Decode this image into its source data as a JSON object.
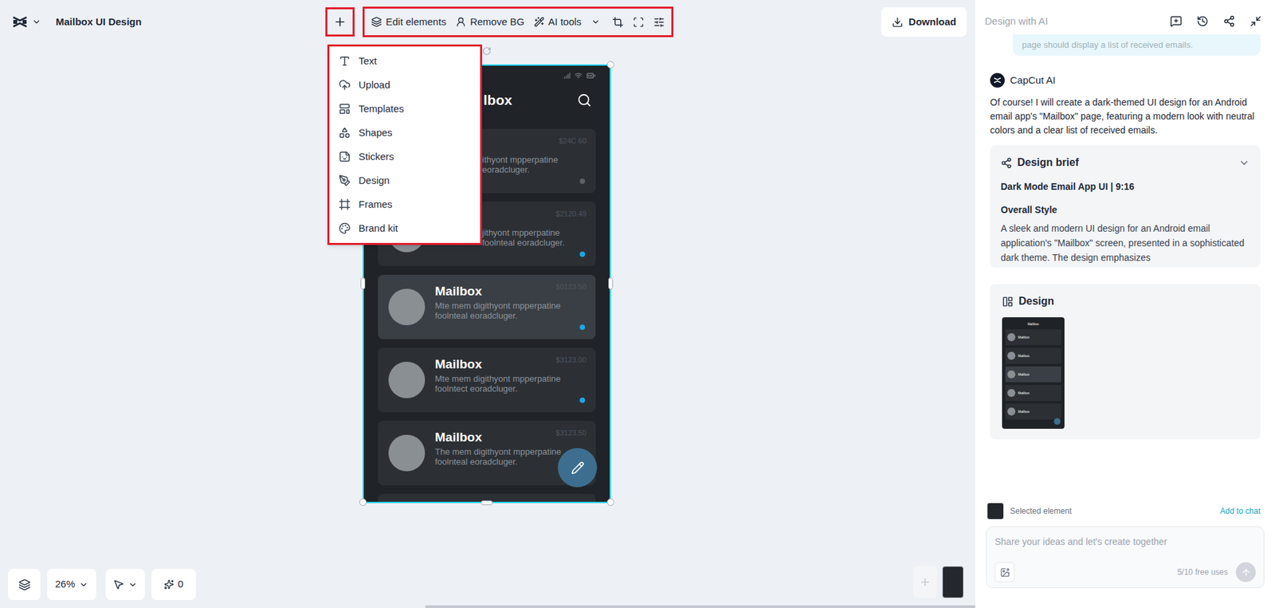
{
  "app": {
    "title": "Mailbox UI Design"
  },
  "toolbar": [
    {
      "label": "Edit elements"
    },
    {
      "label": "Remove BG"
    },
    {
      "label": "AI tools"
    }
  ],
  "download": "Download",
  "add_menu": [
    "Text",
    "Upload",
    "Templates",
    "Shapes",
    "Stickers",
    "Design",
    "Frames",
    "Brand kit"
  ],
  "phone": {
    "header": "lbox",
    "emails": [
      {
        "kind": "covered",
        "title": "",
        "time": "$24C 60",
        "lines": [
          "ithyont mpperpatine",
          "eoradcluger."
        ],
        "unread": false,
        "selected": false
      },
      {
        "kind": "covered",
        "title": "",
        "time": "$2120.49",
        "lines": [
          "jithyont mpperpatine",
          "foolnteal eoradcluger."
        ],
        "unread": true,
        "selected": false
      },
      {
        "kind": "full",
        "title": "Mailbox",
        "time": "$0123.50",
        "lines": [
          "Mte mem digithyont mpperpatine",
          "foolnteal eoradcluger."
        ],
        "unread": true,
        "selected": true
      },
      {
        "kind": "full",
        "title": "Mailbox",
        "time": "$3123.00",
        "lines": [
          "Mte mem digithyont mpperpatine",
          "foolntect eoradcluger."
        ],
        "unread": true,
        "selected": false
      },
      {
        "kind": "full",
        "title": "Mailbox",
        "time": "$3123.50",
        "lines": [
          "The mem digithyont mpperpatine",
          "foolnteal eoradcluger."
        ],
        "unread": false,
        "selected": false
      }
    ]
  },
  "zoom": "26%",
  "credits": "0",
  "panel": {
    "title": "Design with AI",
    "user_message": "page should display a list of received emails.",
    "assistant": "CapCut AI",
    "reply": "Of course! I will create a dark-themed UI design for an Android email app's \"Mailbox\" page, featuring a modern look with neutral colors and a clear list of received emails.",
    "brief": {
      "title": "Design brief",
      "expanded": false,
      "subtitle": "Dark Mode Email App UI | 9:16",
      "section": "Overall Style",
      "text": "A sleek and modern UI design for an Android email application's \"Mailbox\" screen, presented in a sophisticated dark theme. The design emphasizes"
    },
    "design": {
      "title": "Design",
      "thumb_header": "Mailbox",
      "thumb_rows": [
        "Mailbox",
        "Mailbox",
        "Mailbox",
        "Mailbox",
        "Mailbox"
      ]
    },
    "selected_element": "Selected element",
    "add_to_chat": "Add to chat",
    "placeholder": "Share your ideas and let's create together",
    "uses": "5/10 free uses"
  }
}
